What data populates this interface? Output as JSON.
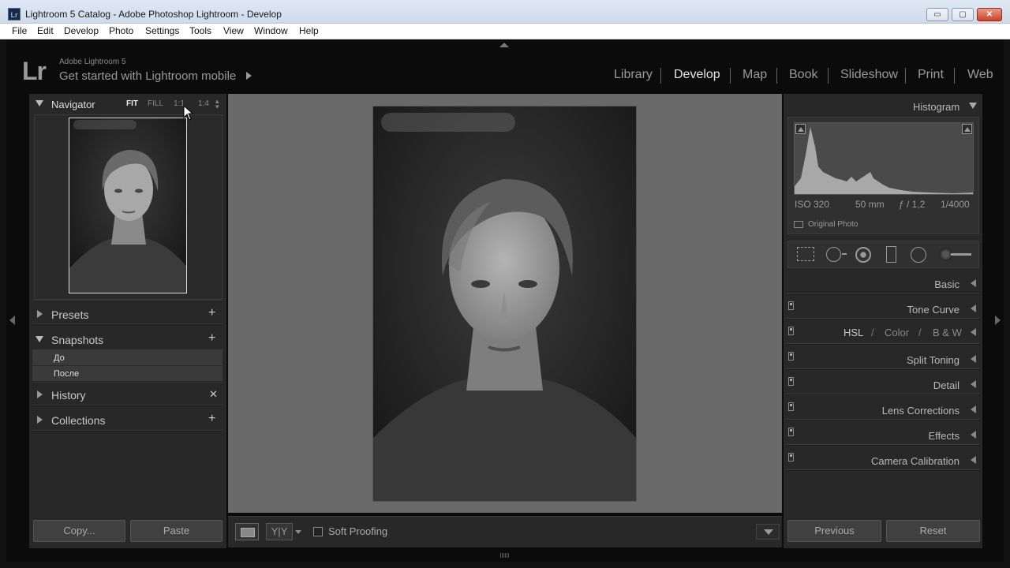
{
  "window": {
    "app_icon": "Lr",
    "title": "Lightroom 5 Catalog - Adobe Photoshop Lightroom - Develop",
    "minimize": "▭",
    "maximize": "▢",
    "close": "✕"
  },
  "menu": [
    "File",
    "Edit",
    "Develop",
    "Photo",
    "Settings",
    "Tools",
    "View",
    "Window",
    "Help"
  ],
  "identity": {
    "logo": "Lr",
    "product": "Adobe Lightroom 5",
    "mobile_prompt": "Get started with Lightroom mobile"
  },
  "modules": [
    "Library",
    "Develop",
    "Map",
    "Book",
    "Slideshow",
    "Print",
    "Web"
  ],
  "active_module": "Develop",
  "left_panel": {
    "navigator": {
      "title": "Navigator",
      "zoom_options": [
        "FIT",
        "FILL",
        "1:1",
        "1:4"
      ],
      "active_zoom": "FIT"
    },
    "presets": {
      "title": "Presets",
      "action": "+"
    },
    "snapshots": {
      "title": "Snapshots",
      "action": "+",
      "items": [
        "До",
        "После"
      ]
    },
    "history": {
      "title": "History",
      "action": "✕"
    },
    "collections": {
      "title": "Collections",
      "action": "+"
    },
    "copy_button": "Copy...",
    "paste_button": "Paste"
  },
  "toolbar": {
    "view_compare": "Y|Y",
    "soft_proofing": "Soft Proofing",
    "soft_proofing_checked": false
  },
  "right_panel": {
    "histogram": {
      "title": "Histogram",
      "iso": "ISO 320",
      "focal": "50 mm",
      "aperture": "ƒ / 1,2",
      "shutter": "1/4000",
      "original_photo": "Original Photo"
    },
    "sections": [
      "Basic",
      "Tone Curve",
      "Split Toning",
      "Detail",
      "Lens Corrections",
      "Effects",
      "Camera Calibration"
    ],
    "hsl": {
      "hsl": "HSL",
      "color": "Color",
      "bw": "B & W",
      "sep": "/"
    },
    "previous_button": "Previous",
    "reset_button": "Reset"
  }
}
